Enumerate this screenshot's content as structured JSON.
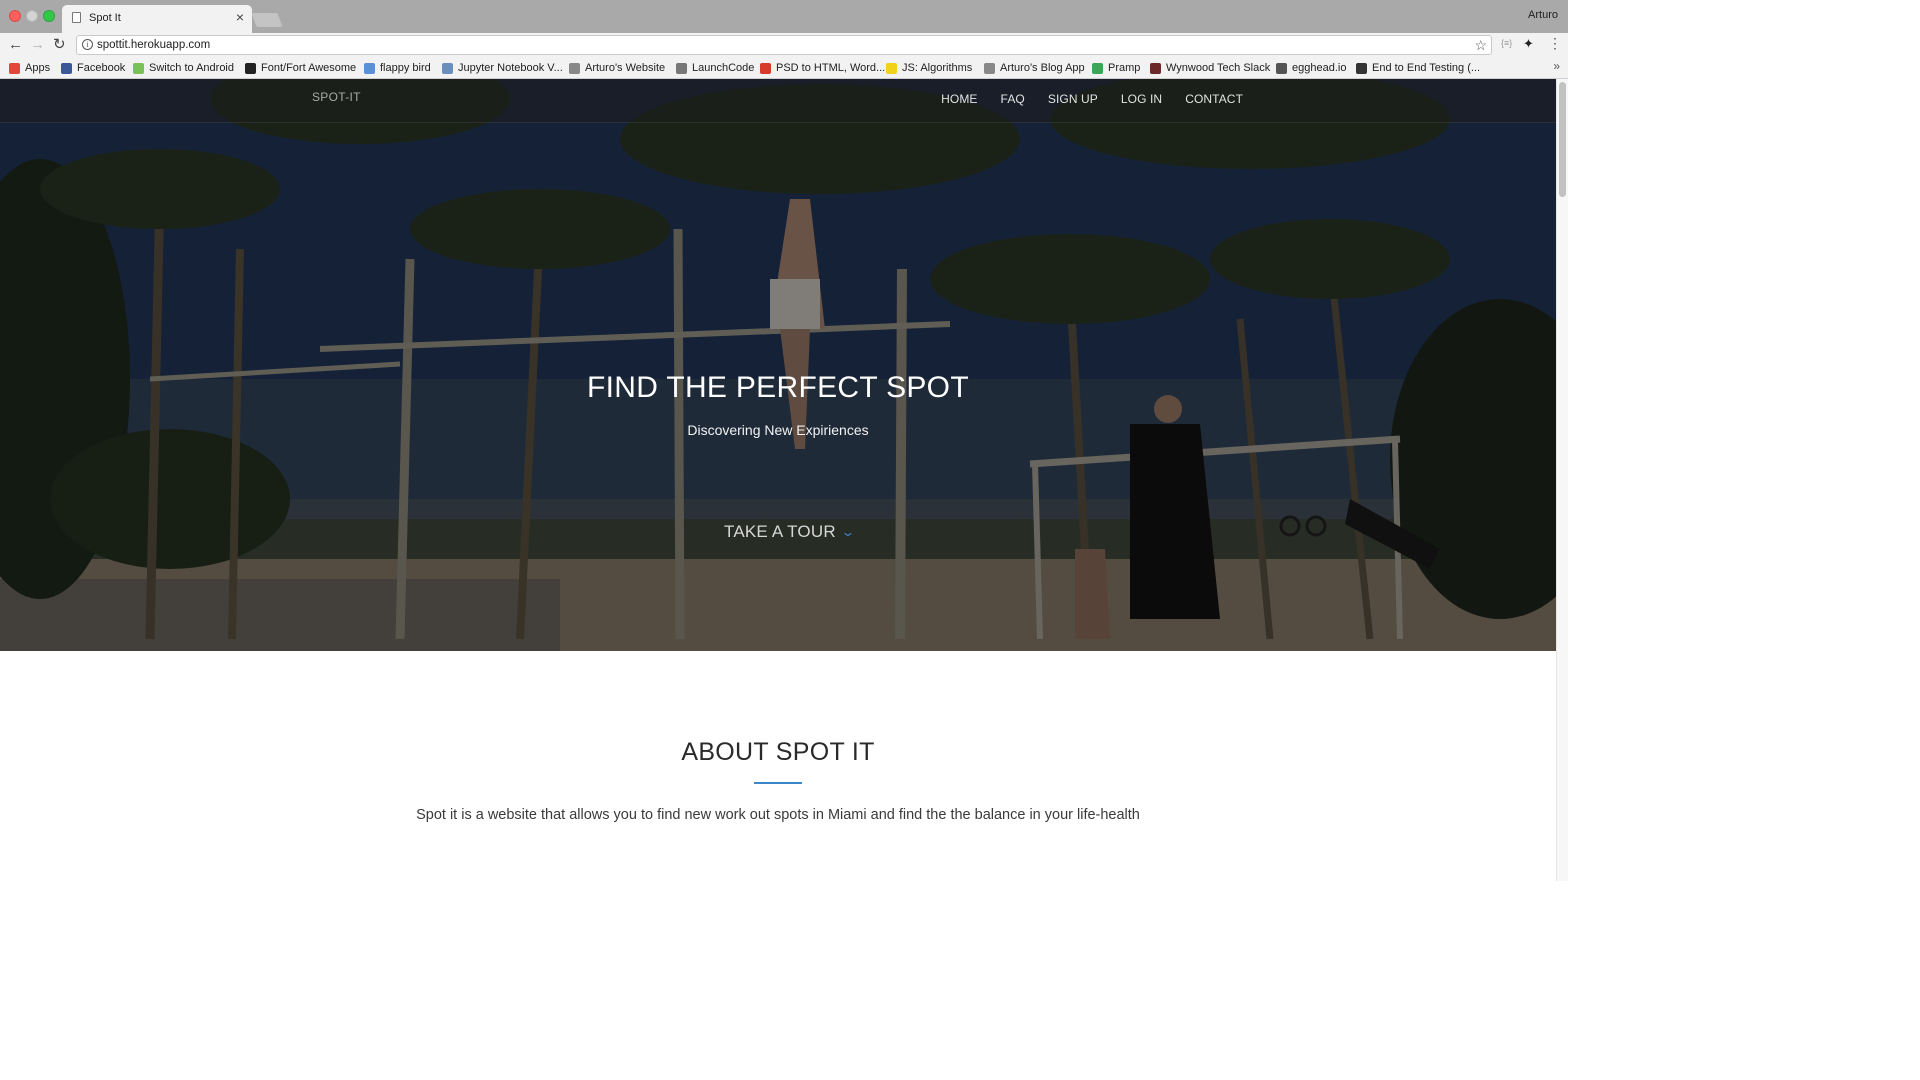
{
  "browser": {
    "tab_title": "Spot It",
    "profile_name": "Arturo",
    "url": "spottit.herokuapp.com",
    "bookmarks": [
      {
        "label": "Apps",
        "icon": "apps-grid-icon",
        "color": "#e0493a"
      },
      {
        "label": "Facebook",
        "icon": "facebook-icon",
        "color": "#3b5998"
      },
      {
        "label": "Switch to Android",
        "icon": "android-icon",
        "color": "#78c257"
      },
      {
        "label": "Font/Fort Awesome",
        "icon": "flag-icon",
        "color": "#222222"
      },
      {
        "label": "flappy bird",
        "icon": "bird-icon",
        "color": "#5b8fd8"
      },
      {
        "label": "Jupyter Notebook V...",
        "icon": "notebook-icon",
        "color": "#6a8fbf"
      },
      {
        "label": "Arturo's Website",
        "icon": "page-icon",
        "color": "#888888"
      },
      {
        "label": "LaunchCode",
        "icon": "rocket-icon",
        "color": "#777777"
      },
      {
        "label": "PSD to HTML, Word...",
        "icon": "code-icon",
        "color": "#d63a2b"
      },
      {
        "label": "JS: Algorithms",
        "icon": "js-icon",
        "color": "#f0d21b"
      },
      {
        "label": "Arturo's Blog App",
        "icon": "page-icon",
        "color": "#888888"
      },
      {
        "label": "Pramp",
        "icon": "check-circle-icon",
        "color": "#3aa757"
      },
      {
        "label": "Wynwood Tech Slack",
        "icon": "slack-hash-icon",
        "color": "#6b2a2a"
      },
      {
        "label": "egghead.io",
        "icon": "egghead-icon",
        "color": "#555555"
      },
      {
        "label": "End to End Testing (...",
        "icon": "testing-icon",
        "color": "#333333"
      }
    ]
  },
  "site": {
    "brand": "SPOT-IT",
    "nav": [
      "HOME",
      "FAQ",
      "SIGN UP",
      "LOG IN",
      "CONTACT"
    ],
    "hero": {
      "title": "FIND THE PERFECT SPOT",
      "subtitle": "Discovering New Expiriences",
      "cta": "TAKE A TOUR"
    },
    "about": {
      "title": "ABOUT SPOT IT",
      "text": "Spot it is a website that allows you to find new work out spots in Miami and find the the balance in your life-health"
    },
    "accent_color": "#3a86c9"
  }
}
